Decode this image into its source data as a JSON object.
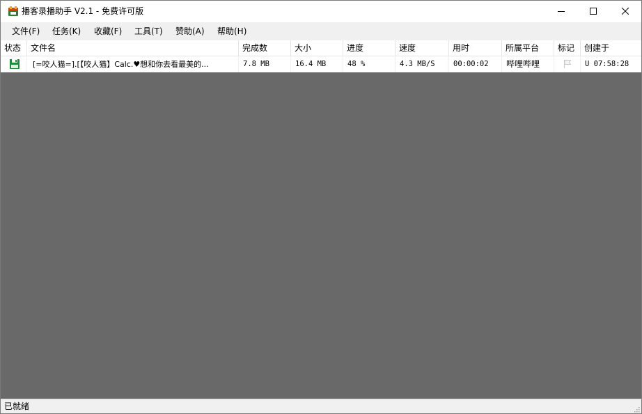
{
  "window": {
    "title": "播客录播助手 V2.1 - 免费许可版",
    "icon": "app-icon",
    "controls": [
      "minimize-icon",
      "maximize-icon",
      "close-icon"
    ]
  },
  "menu": [
    {
      "label": "文件(F)"
    },
    {
      "label": "任务(K)"
    },
    {
      "label": "收藏(F)"
    },
    {
      "label": "工具(T)"
    },
    {
      "label": "赞助(A)"
    },
    {
      "label": "帮助(H)"
    }
  ],
  "table": {
    "columns": [
      "状态",
      "文件名",
      "完成数",
      "大小",
      "进度",
      "速度",
      "用时",
      "所属平台",
      "标记",
      "创建于"
    ],
    "rows": [
      {
        "status_icon": "save-icon",
        "filename": "[=咬人猫=].[【咬人猫】Calc.♥想和你去看最美的...",
        "done": "7.8 MB",
        "size": "16.4 MB",
        "progress": "48 %",
        "speed": "4.3 MB/S",
        "elapsed": "00:00:02",
        "platform": "哔哩哔哩",
        "mark_icon": "flag-icon",
        "created": "U 07:58:28"
      }
    ]
  },
  "statusbar": {
    "text": "已就绪"
  },
  "colors": {
    "empty_area": "#696969",
    "menubar": "#f0f0f0",
    "save_icon": "#1e8a3a"
  }
}
